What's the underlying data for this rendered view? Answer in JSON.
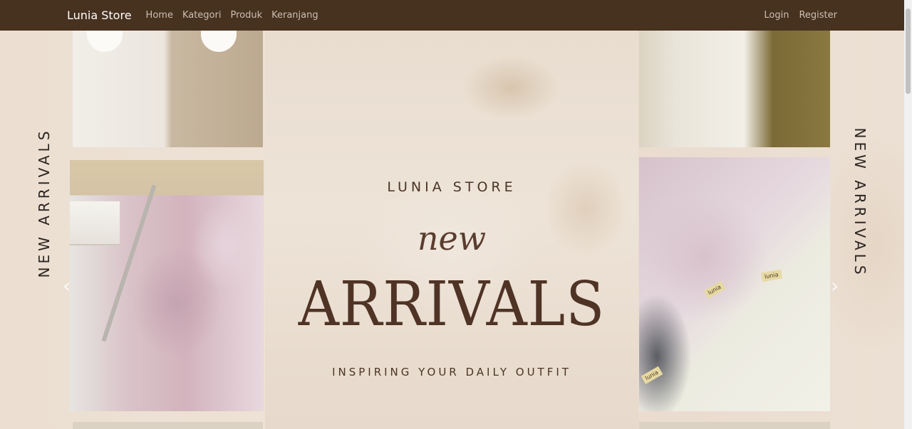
{
  "navbar": {
    "brand": "Lunia Store",
    "links": [
      "Home",
      "Kategori",
      "Produk",
      "Keranjang"
    ],
    "right_links": [
      "Login",
      "Register"
    ]
  },
  "hero": {
    "store_title": "LUNIA STORE",
    "new_word": "new",
    "arrivals_word": "ARRIVALS",
    "tagline": "INSPIRING YOUR DAILY OUTFIT",
    "side_text_left": "NEW ARRIVALS",
    "side_text_right": "NEW ARRIVALS",
    "prev_icon": "chevron-left-icon",
    "next_icon": "chevron-right-icon"
  },
  "product_tags": [
    "lunia",
    "lunia",
    "lunia"
  ],
  "colors": {
    "navbar_bg": "#47311f",
    "brand_text": "#ffffff",
    "nav_text": "#cdbfb2",
    "hero_text": "#4a3426"
  }
}
